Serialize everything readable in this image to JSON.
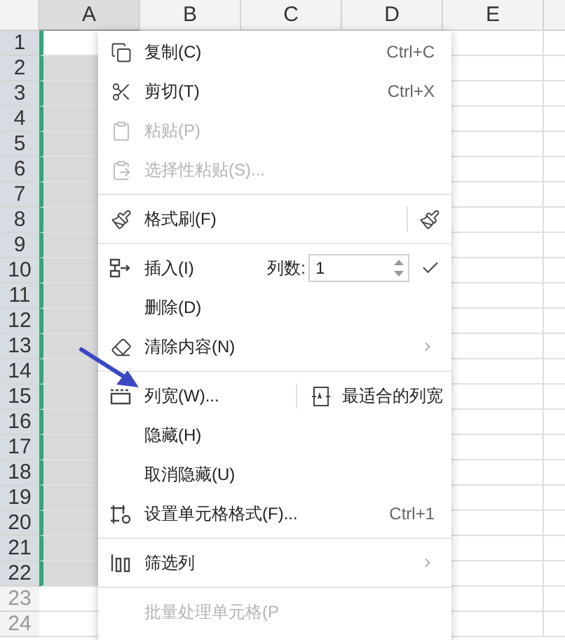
{
  "columns": [
    {
      "label": "A",
      "selected": true
    },
    {
      "label": "B",
      "selected": false
    },
    {
      "label": "C",
      "selected": false
    },
    {
      "label": "D",
      "selected": false
    },
    {
      "label": "E",
      "selected": false
    }
  ],
  "rows": [
    {
      "label": "1",
      "selected": true,
      "active": true
    },
    {
      "label": "2",
      "selected": true,
      "active": false
    },
    {
      "label": "3",
      "selected": true,
      "active": false
    },
    {
      "label": "4",
      "selected": true,
      "active": false
    },
    {
      "label": "5",
      "selected": true,
      "active": false
    },
    {
      "label": "6",
      "selected": true,
      "active": false
    },
    {
      "label": "7",
      "selected": true,
      "active": false
    },
    {
      "label": "8",
      "selected": true,
      "active": false
    },
    {
      "label": "9",
      "selected": true,
      "active": false
    },
    {
      "label": "10",
      "selected": true,
      "active": false
    },
    {
      "label": "11",
      "selected": true,
      "active": false
    },
    {
      "label": "12",
      "selected": true,
      "active": false
    },
    {
      "label": "13",
      "selected": true,
      "active": false
    },
    {
      "label": "14",
      "selected": true,
      "active": false
    },
    {
      "label": "15",
      "selected": true,
      "active": false
    },
    {
      "label": "16",
      "selected": true,
      "active": false
    },
    {
      "label": "17",
      "selected": true,
      "active": false
    },
    {
      "label": "18",
      "selected": true,
      "active": false
    },
    {
      "label": "19",
      "selected": true,
      "active": false
    },
    {
      "label": "20",
      "selected": true,
      "active": false
    },
    {
      "label": "21",
      "selected": true,
      "active": false
    },
    {
      "label": "22",
      "selected": true,
      "active": false
    },
    {
      "label": "23",
      "selected": false,
      "active": false
    },
    {
      "label": "24",
      "selected": false,
      "active": false
    }
  ],
  "context_menu": {
    "items": [
      {
        "kind": "copy",
        "label": "复制(C)",
        "shortcut": "Ctrl+C",
        "disabled": false
      },
      {
        "kind": "cut",
        "label": "剪切(T)",
        "shortcut": "Ctrl+X",
        "disabled": false
      },
      {
        "kind": "paste",
        "label": "粘贴(P)",
        "disabled": true
      },
      {
        "kind": "pastespecial",
        "label": "选择性粘贴(S)...",
        "disabled": true
      },
      {
        "kind": "separator"
      },
      {
        "kind": "painter",
        "label": "格式刷(F)",
        "disabled": false
      },
      {
        "kind": "separator"
      },
      {
        "kind": "insert",
        "label": "插入(I)",
        "count_label": "列数:",
        "count_value": "1",
        "disabled": false
      },
      {
        "kind": "plain",
        "label": "删除(D)",
        "disabled": false
      },
      {
        "kind": "clear",
        "label": "清除内容(N)",
        "disabled": false,
        "submenu": true
      },
      {
        "kind": "separator"
      },
      {
        "kind": "width",
        "label": "列宽(W)...",
        "autofit_label": "最适合的列宽",
        "disabled": false
      },
      {
        "kind": "plain",
        "label": "隐藏(H)",
        "disabled": false
      },
      {
        "kind": "plain",
        "label": "取消隐藏(U)",
        "disabled": false
      },
      {
        "kind": "format",
        "label": "设置单元格格式(F)...",
        "shortcut": "Ctrl+1",
        "disabled": false
      },
      {
        "kind": "separator"
      },
      {
        "kind": "filter",
        "label": "筛选列",
        "disabled": false,
        "submenu": true
      },
      {
        "kind": "separator"
      },
      {
        "kind": "plain",
        "label": "批量处理单元格(P",
        "disabled": true
      }
    ]
  }
}
